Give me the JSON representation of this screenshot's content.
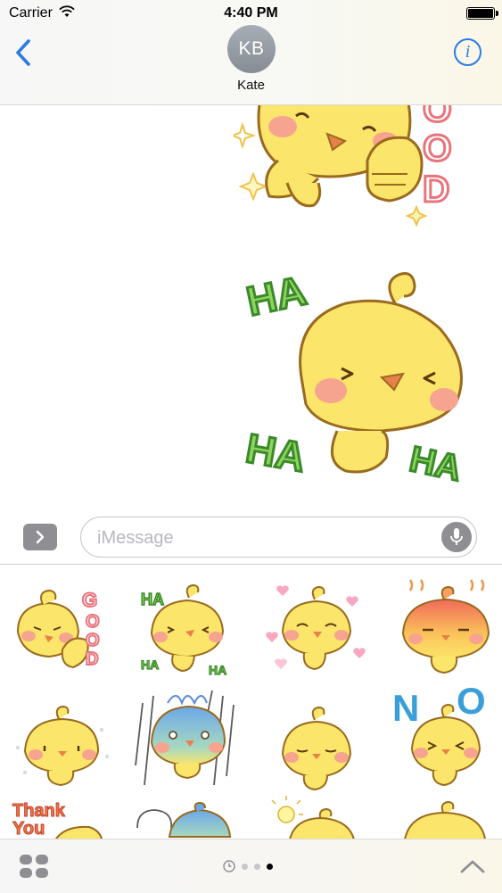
{
  "status_bar": {
    "carrier": "Carrier",
    "time": "4:40 PM"
  },
  "nav": {
    "avatar_initials": "KB",
    "contact_name": "Kate",
    "info_glyph": "i",
    "back_icon": "chevron-left-icon"
  },
  "thread": {
    "sticker_good_text": "GOOD",
    "sticker_haha_text": [
      "HA",
      "HA",
      "HA"
    ]
  },
  "input": {
    "placeholder": "iMessage",
    "apps_toggle_icon": "chevron-right-icon",
    "mic_icon": "microphone-icon"
  },
  "drawer": {
    "stickers": [
      {
        "name": "chick-good",
        "caption": "GOOD"
      },
      {
        "name": "chick-haha",
        "caption": "HA"
      },
      {
        "name": "chick-hearts",
        "caption": ""
      },
      {
        "name": "chick-angry",
        "caption": ""
      },
      {
        "name": "chick-sparkle",
        "caption": ""
      },
      {
        "name": "chick-rain",
        "caption": ""
      },
      {
        "name": "chick-idle",
        "caption": ""
      },
      {
        "name": "chick-no",
        "caption": "NO"
      },
      {
        "name": "chick-thank-you",
        "caption": "Thank You"
      },
      {
        "name": "chick-speech",
        "caption": ""
      },
      {
        "name": "chick-idea",
        "caption": ""
      },
      {
        "name": "chick-peek",
        "caption": ""
      }
    ]
  },
  "bottom_bar": {
    "pages": 3,
    "active_page": 3,
    "recent_icon": "clock-icon",
    "app_drawer_icon": "app-grid-icon",
    "expand_icon": "chevron-up-icon"
  },
  "colors": {
    "accent": "#2b7be3",
    "chick_yellow": "#fbe56a",
    "chick_outline": "#9a6a1f",
    "blush": "#f6a48f",
    "beak": "#e8804a",
    "good_pink": "#e8747c",
    "ha_green": "#6cc04a",
    "no_blue": "#3a9fd8"
  }
}
